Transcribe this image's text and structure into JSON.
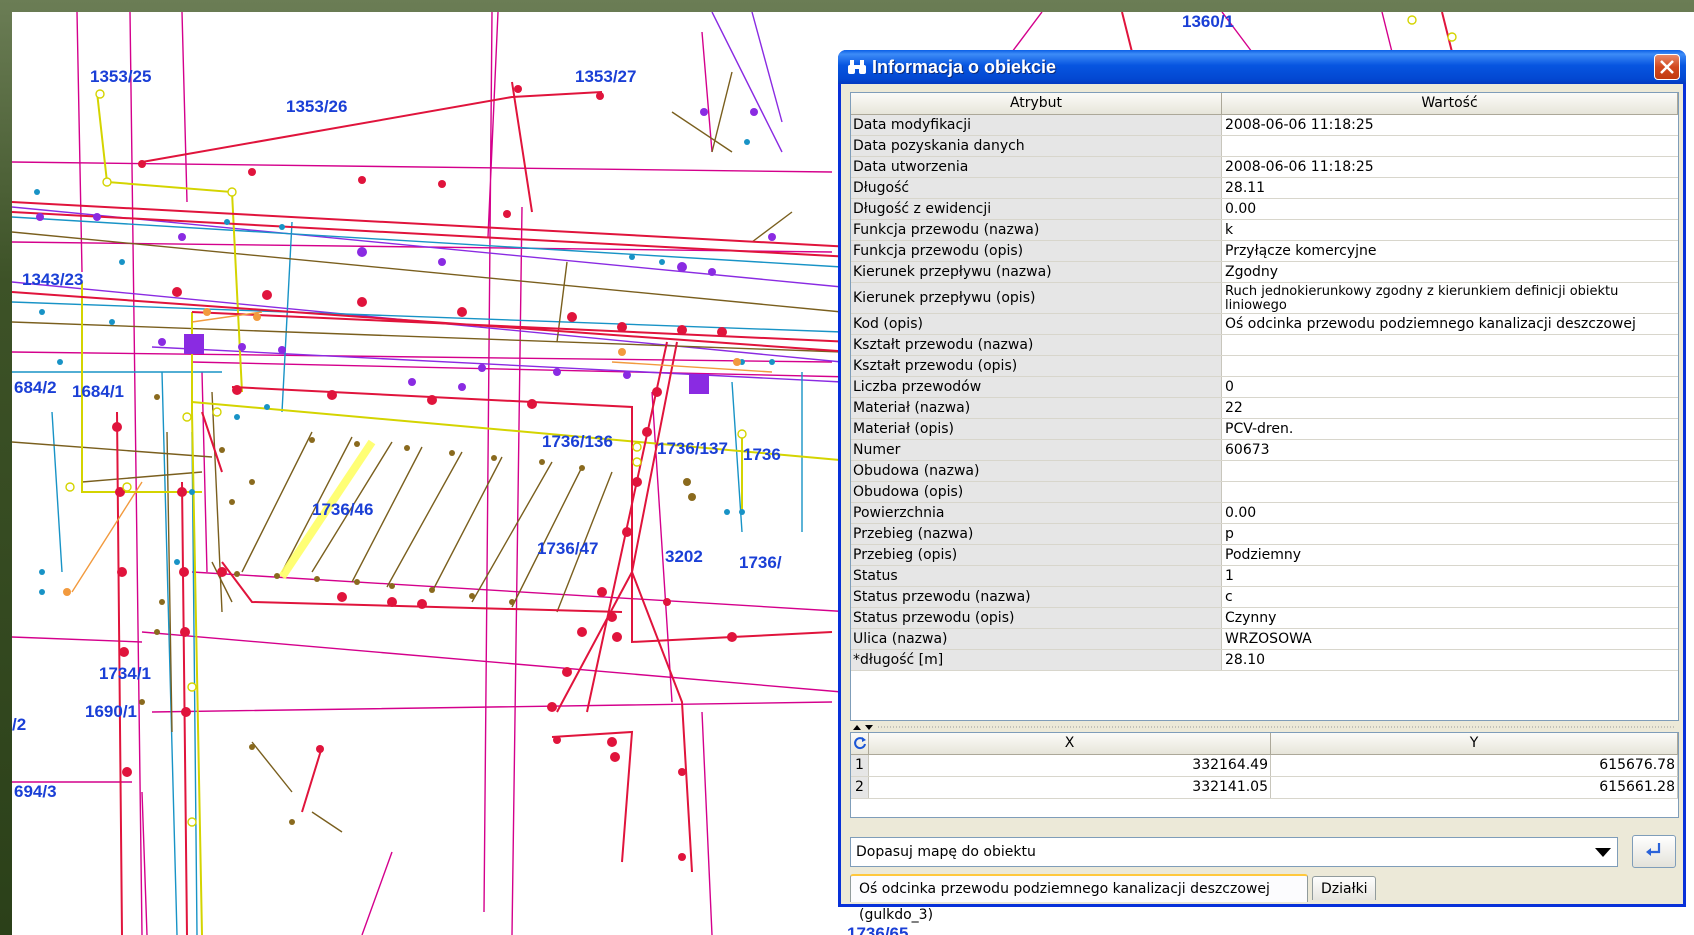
{
  "map": {
    "parcel_labels": [
      "1353/25",
      "1353/26",
      "1353/27",
      "1360/1",
      "1343/23",
      "684/2",
      "1684/1",
      "1736/136",
      "1736/137",
      "1736",
      "1736/46",
      "1736/47",
      "3202",
      "1736/",
      "1734/1",
      "1690/1",
      "/2",
      "694/3",
      "1736/65"
    ]
  },
  "window": {
    "title": "Informacja o obiekcie",
    "icon": "binoculars-icon",
    "close_icon": "close-icon"
  },
  "attributes": {
    "headers": {
      "attr": "Atrybut",
      "value": "Wartość"
    },
    "rows": [
      {
        "a": "Data modyfikacji",
        "v": "2008-06-06 11:18:25"
      },
      {
        "a": "Data pozyskania danych",
        "v": ""
      },
      {
        "a": "Data utworzenia",
        "v": "2008-06-06 11:18:25"
      },
      {
        "a": "Długość",
        "v": "28.11"
      },
      {
        "a": "Długość z ewidencji",
        "v": "0.00"
      },
      {
        "a": "Funkcja przewodu (nazwa)",
        "v": "k"
      },
      {
        "a": "Funkcja przewodu (opis)",
        "v": "Przyłącze komercyjne"
      },
      {
        "a": "Kierunek przepływu (nazwa)",
        "v": "Zgodny"
      },
      {
        "a": "Kierunek przepływu (opis)",
        "v": "Ruch jednokierunkowy zgodny z kierunkiem definicji obiektu liniowego"
      },
      {
        "a": "Kod (opis)",
        "v": "Oś odcinka przewodu podziemnego kanalizacji deszczowej"
      },
      {
        "a": "Kształt przewodu (nazwa)",
        "v": ""
      },
      {
        "a": "Kształt przewodu (opis)",
        "v": ""
      },
      {
        "a": "Liczba przewodów",
        "v": "0"
      },
      {
        "a": "Materiał (nazwa)",
        "v": "22"
      },
      {
        "a": "Materiał (opis)",
        "v": "PCV-dren."
      },
      {
        "a": "Numer",
        "v": "60673"
      },
      {
        "a": "Obudowa (nazwa)",
        "v": ""
      },
      {
        "a": "Obudowa (opis)",
        "v": ""
      },
      {
        "a": "Powierzchnia",
        "v": "0.00"
      },
      {
        "a": "Przebieg (nazwa)",
        "v": "p"
      },
      {
        "a": "Przebieg (opis)",
        "v": "Podziemny"
      },
      {
        "a": "Status",
        "v": "1"
      },
      {
        "a": "Status przewodu (nazwa)",
        "v": "c"
      },
      {
        "a": "Status przewodu (opis)",
        "v": "Czynny"
      },
      {
        "a": "Ulica (nazwa)",
        "v": "WRZOSOWA"
      },
      {
        "a": "*długość [m]",
        "v": "28.10"
      }
    ]
  },
  "coords": {
    "headers": {
      "x": "X",
      "y": "Y"
    },
    "rows": [
      {
        "n": "1",
        "x": "332164.49",
        "y": "615676.78"
      },
      {
        "n": "2",
        "x": "332141.05",
        "y": "615661.28"
      }
    ]
  },
  "combo": {
    "value": "Dopasuj mapę do obiektu"
  },
  "tabs": {
    "active": "Oś odcinka przewodu podziemnego kanalizacji deszczowej (gulkdo_3)",
    "inactive": "Działki"
  }
}
